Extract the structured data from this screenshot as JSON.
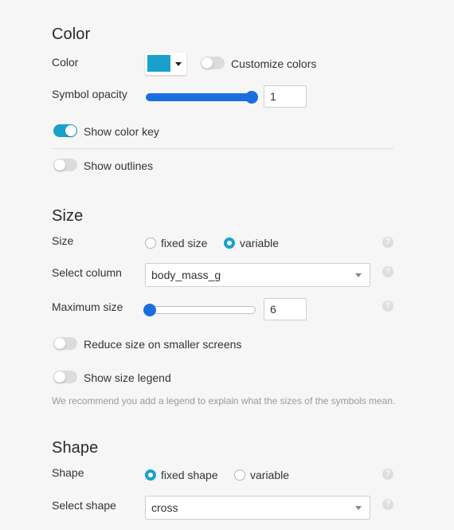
{
  "colors": {
    "accent": "#18a1cd",
    "slider": "#1a6fe0",
    "swatch": "#18a1cd"
  },
  "color_section": {
    "title": "Color",
    "color_label": "Color",
    "customize_label": "Customize colors",
    "customize_on": false,
    "opacity_label": "Symbol opacity",
    "opacity_value": "1",
    "opacity_level": 1.0,
    "show_key_label": "Show color key",
    "show_key_on": true,
    "show_outlines_label": "Show outlines",
    "show_outlines_on": false
  },
  "size_section": {
    "title": "Size",
    "size_label": "Size",
    "size_options": [
      "fixed size",
      "variable"
    ],
    "size_selected": "variable",
    "select_column_label": "Select column",
    "select_column_value": "body_mass_g",
    "max_size_label": "Maximum size",
    "max_size_value": "6",
    "max_size_level": 0.0,
    "reduce_label": "Reduce size on smaller screens",
    "reduce_on": false,
    "legend_label": "Show size legend",
    "legend_on": false,
    "hint": "We recommend you add a legend to explain what the sizes of the symbols mean."
  },
  "shape_section": {
    "title": "Shape",
    "shape_label": "Shape",
    "shape_options": [
      "fixed shape",
      "variable"
    ],
    "shape_selected": "fixed shape",
    "select_shape_label": "Select shape",
    "select_shape_value": "cross"
  },
  "help_glyph": "?"
}
